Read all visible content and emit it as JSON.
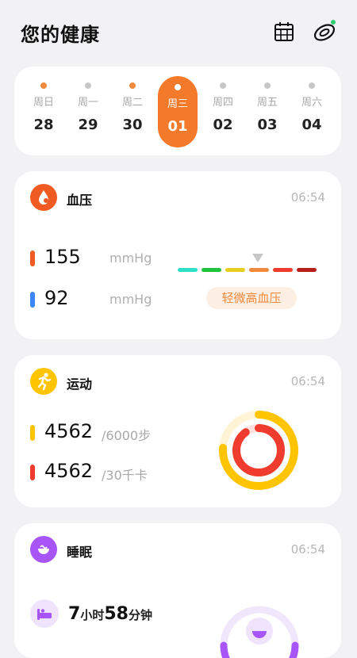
{
  "header": {
    "title": "您的健康",
    "calendar_icon": "calendar-icon",
    "band_icon": "smart-band-icon",
    "band_status_color": "#2ecc71"
  },
  "week": [
    {
      "weekday": "周日",
      "date": "28",
      "dot": "orange",
      "selected": false
    },
    {
      "weekday": "周一",
      "date": "29",
      "dot": "gray",
      "selected": false
    },
    {
      "weekday": "周二",
      "date": "30",
      "dot": "orange",
      "selected": false
    },
    {
      "weekday": "周三",
      "date": "01",
      "dot": "white",
      "selected": true
    },
    {
      "weekday": "周四",
      "date": "02",
      "dot": "gray",
      "selected": false
    },
    {
      "weekday": "周五",
      "date": "03",
      "dot": "gray",
      "selected": false
    },
    {
      "weekday": "周六",
      "date": "04",
      "dot": "gray",
      "selected": false
    }
  ],
  "blood_pressure": {
    "title": "血压",
    "time": "06:54",
    "systolic": "155",
    "diastolic": "92",
    "unit": "mmHg",
    "level_label": "轻微高血压",
    "scale_colors": [
      "#2fe0c8",
      "#1fc23f",
      "#e8cf1f",
      "#f08a3c",
      "#f03c2e",
      "#b81f1a"
    ],
    "level_index": 3,
    "accent": "#f05a23"
  },
  "sport": {
    "title": "运动",
    "time": "06:54",
    "steps": "4562",
    "steps_goal": "/6000步",
    "calories": "4562",
    "calories_goal": "/30千卡",
    "steps_progress": 0.76,
    "calories_progress": 0.9,
    "accent": "#ffc400",
    "secondary": "#f03c2e"
  },
  "sleep": {
    "title": "睡眠",
    "time": "06:54",
    "hours": "7",
    "hours_unit": "小时",
    "minutes": "58",
    "minutes_unit": "分钟",
    "accent": "#a855f7"
  }
}
